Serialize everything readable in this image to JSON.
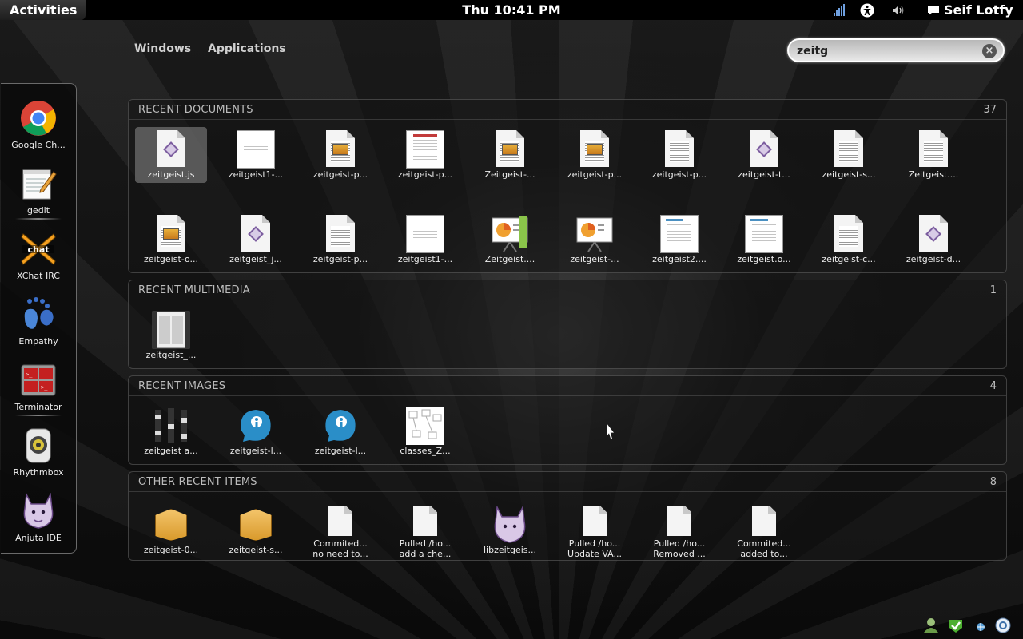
{
  "panel": {
    "activities": "Activities",
    "clock": "Thu 10:41 PM",
    "user": "Seif Lotfy"
  },
  "view_selector": {
    "windows": "Windows",
    "applications": "Applications"
  },
  "search": {
    "value": "zeitg",
    "placeholder": ""
  },
  "dash": {
    "items": [
      {
        "label": "Google Ch...",
        "icon": "chrome-icon"
      },
      {
        "label": "gedit",
        "icon": "gedit-icon"
      },
      {
        "label": "XChat IRC",
        "icon": "xchat-icon"
      },
      {
        "label": "Empathy",
        "icon": "empathy-icon"
      },
      {
        "label": "Terminator",
        "icon": "terminator-icon"
      },
      {
        "label": "Rhythmbox",
        "icon": "rhythmbox-icon"
      },
      {
        "label": "Anjuta IDE",
        "icon": "anjuta-icon"
      }
    ]
  },
  "sections": {
    "documents": {
      "title": "RECENT DOCUMENTS",
      "count": "37",
      "items": [
        {
          "name": "zeitgeist.js",
          "kind": "js"
        },
        {
          "name": "zeitgeist1-...",
          "kind": "sheet"
        },
        {
          "name": "zeitgeist-p...",
          "kind": "pic"
        },
        {
          "name": "zeitgeist-p...",
          "kind": "sheet-red"
        },
        {
          "name": "Zeitgeist-...",
          "kind": "pic"
        },
        {
          "name": "zeitgeist-p...",
          "kind": "pic"
        },
        {
          "name": "zeitgeist-p...",
          "kind": "text"
        },
        {
          "name": "zeitgeist-t...",
          "kind": "js"
        },
        {
          "name": "zeitgeist-s...",
          "kind": "text"
        },
        {
          "name": "Zeitgeist....",
          "kind": "text"
        },
        {
          "name": "zeitgeist-o...",
          "kind": "pic"
        },
        {
          "name": "zeitgeist_j...",
          "kind": "js"
        },
        {
          "name": "zeitgeist-p...",
          "kind": "text"
        },
        {
          "name": "zeitgeist1-...",
          "kind": "sheet"
        },
        {
          "name": "Zeitgeist....",
          "kind": "presentation-green"
        },
        {
          "name": "zeitgeist-...",
          "kind": "presentation"
        },
        {
          "name": "zeitgeist2....",
          "kind": "sheet-blue"
        },
        {
          "name": "zeitgeist.o...",
          "kind": "sheet-blue"
        },
        {
          "name": "zeitgeist-c...",
          "kind": "text"
        },
        {
          "name": "zeitgeist-d...",
          "kind": "js"
        }
      ]
    },
    "multimedia": {
      "title": "RECENT MULTIMEDIA",
      "count": "1",
      "items": [
        {
          "name": "zeitgeist_...",
          "kind": "film"
        }
      ]
    },
    "images": {
      "title": "RECENT IMAGES",
      "count": "4",
      "items": [
        {
          "name": "zeitgeist a...",
          "kind": "bars"
        },
        {
          "name": "zeitgeist-l...",
          "kind": "logo"
        },
        {
          "name": "zeitgeist-l...",
          "kind": "logo"
        },
        {
          "name": "classes_Z...",
          "kind": "diagram"
        }
      ]
    },
    "other": {
      "title": "OTHER RECENT ITEMS",
      "count": "8",
      "items": [
        {
          "name": "zeitgeist-0...",
          "name2": "",
          "kind": "package"
        },
        {
          "name": "zeitgeist-s...",
          "name2": "",
          "kind": "package"
        },
        {
          "name": "Commited...",
          "name2": "no need to...",
          "kind": "blank"
        },
        {
          "name": "Pulled /ho...",
          "name2": "add a che...",
          "kind": "blank"
        },
        {
          "name": "libzeitgeis...",
          "name2": "",
          "kind": "anjuta"
        },
        {
          "name": "Pulled /ho...",
          "name2": "Update VA...",
          "kind": "blank"
        },
        {
          "name": "Pulled /ho...",
          "name2": "Removed ...",
          "kind": "blank"
        },
        {
          "name": "Commited...",
          "name2": "added to...",
          "kind": "blank"
        }
      ]
    }
  }
}
